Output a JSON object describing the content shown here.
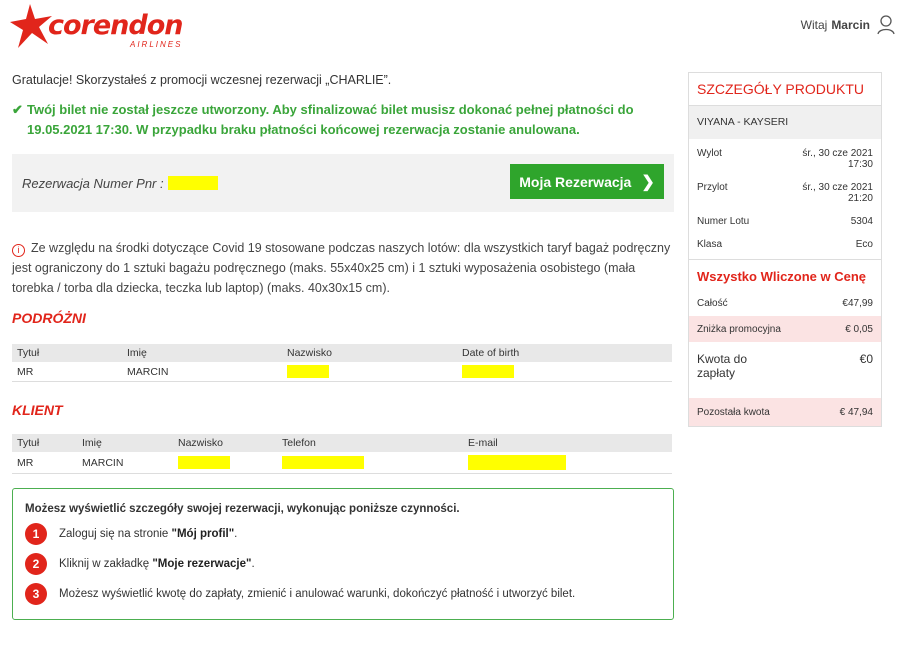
{
  "brand": {
    "name": "corendon",
    "sub": "AIRLINES",
    "color": "#e1251b"
  },
  "user": {
    "greeting": "Witaj",
    "name": "Marcin"
  },
  "congrats": "Gratulacje! Skorzystałeś z promocji wczesnej rezerwacji „CHARLIE”.",
  "notice": "Twój bilet nie został jeszcze utworzony. Aby sfinalizować bilet musisz dokonać pełnej płatności do 19.05.2021 17:30. W przypadku braku płatności końcowej rezerwacja zostanie anulowana.",
  "pnr": {
    "label": "Rezerwacja Numer Pnr :",
    "button": "Moja Rezerwacja"
  },
  "covid": "Ze względu na środki dotyczące Covid 19 stosowane podczas naszych lotów: dla wszystkich taryf bagaż podręczny jest ograniczony do 1 sztuki bagażu podręcznego (maks. 55x40x25 cm) i 1 sztuki wyposażenia osobistego (mała torebka / torba dla dziecka, teczka lub laptop) (maks. 40x30x15 cm).",
  "travellers": {
    "title": "PODRÓŻNI",
    "headers": [
      "Tytuł",
      "Imię",
      "Nazwisko",
      "Date of birth"
    ],
    "row": {
      "title": "MR",
      "first": "MARCIN"
    }
  },
  "client": {
    "title": "KLIENT",
    "headers": [
      "Tytuł",
      "Imię",
      "Nazwisko",
      "Telefon",
      "E-mail"
    ],
    "row": {
      "title": "MR",
      "first": "MARCIN"
    }
  },
  "info": {
    "head": "Możesz wyświetlić szczegóły swojej rezerwacji, wykonując poniższe czynności.",
    "steps": [
      {
        "num": "1",
        "pre": "Zaloguj się na stronie ",
        "bold": "\"Mój profil\"",
        "post": "."
      },
      {
        "num": "2",
        "pre": "Kliknij w zakładkę ",
        "bold": "\"Moje rezerwacje\"",
        "post": "."
      },
      {
        "num": "3",
        "pre": "Możesz wyświetlić kwotę do zapłaty, zmienić i anulować warunki, dokończyć płatność i utworzyć bilet.",
        "bold": "",
        "post": ""
      }
    ]
  },
  "product": {
    "title": "SZCZEGÓŁY PRODUKTU",
    "route": "VIYANA - KAYSERI",
    "departure_label": "Wylot",
    "departure_date": "śr., 30 cze 2021",
    "departure_time": "17:30",
    "arrival_label": "Przylot",
    "arrival_date": "śr., 30 cze 2021",
    "arrival_time": "21:20",
    "flight_label": "Numer Lotu",
    "flight_value": "5304",
    "class_label": "Klasa",
    "class_value": "Eco",
    "allin": "Wszystko Wliczone w Cenę",
    "total_label": "Całość",
    "total_value": "€47,99",
    "discount_label": "Zniżka promocyjna",
    "discount_value": "€ 0,05",
    "due_label": "Kwota do zapłaty",
    "due_value": "€0",
    "remaining_label": "Pozostała kwota",
    "remaining_value": "€ 47,94"
  }
}
